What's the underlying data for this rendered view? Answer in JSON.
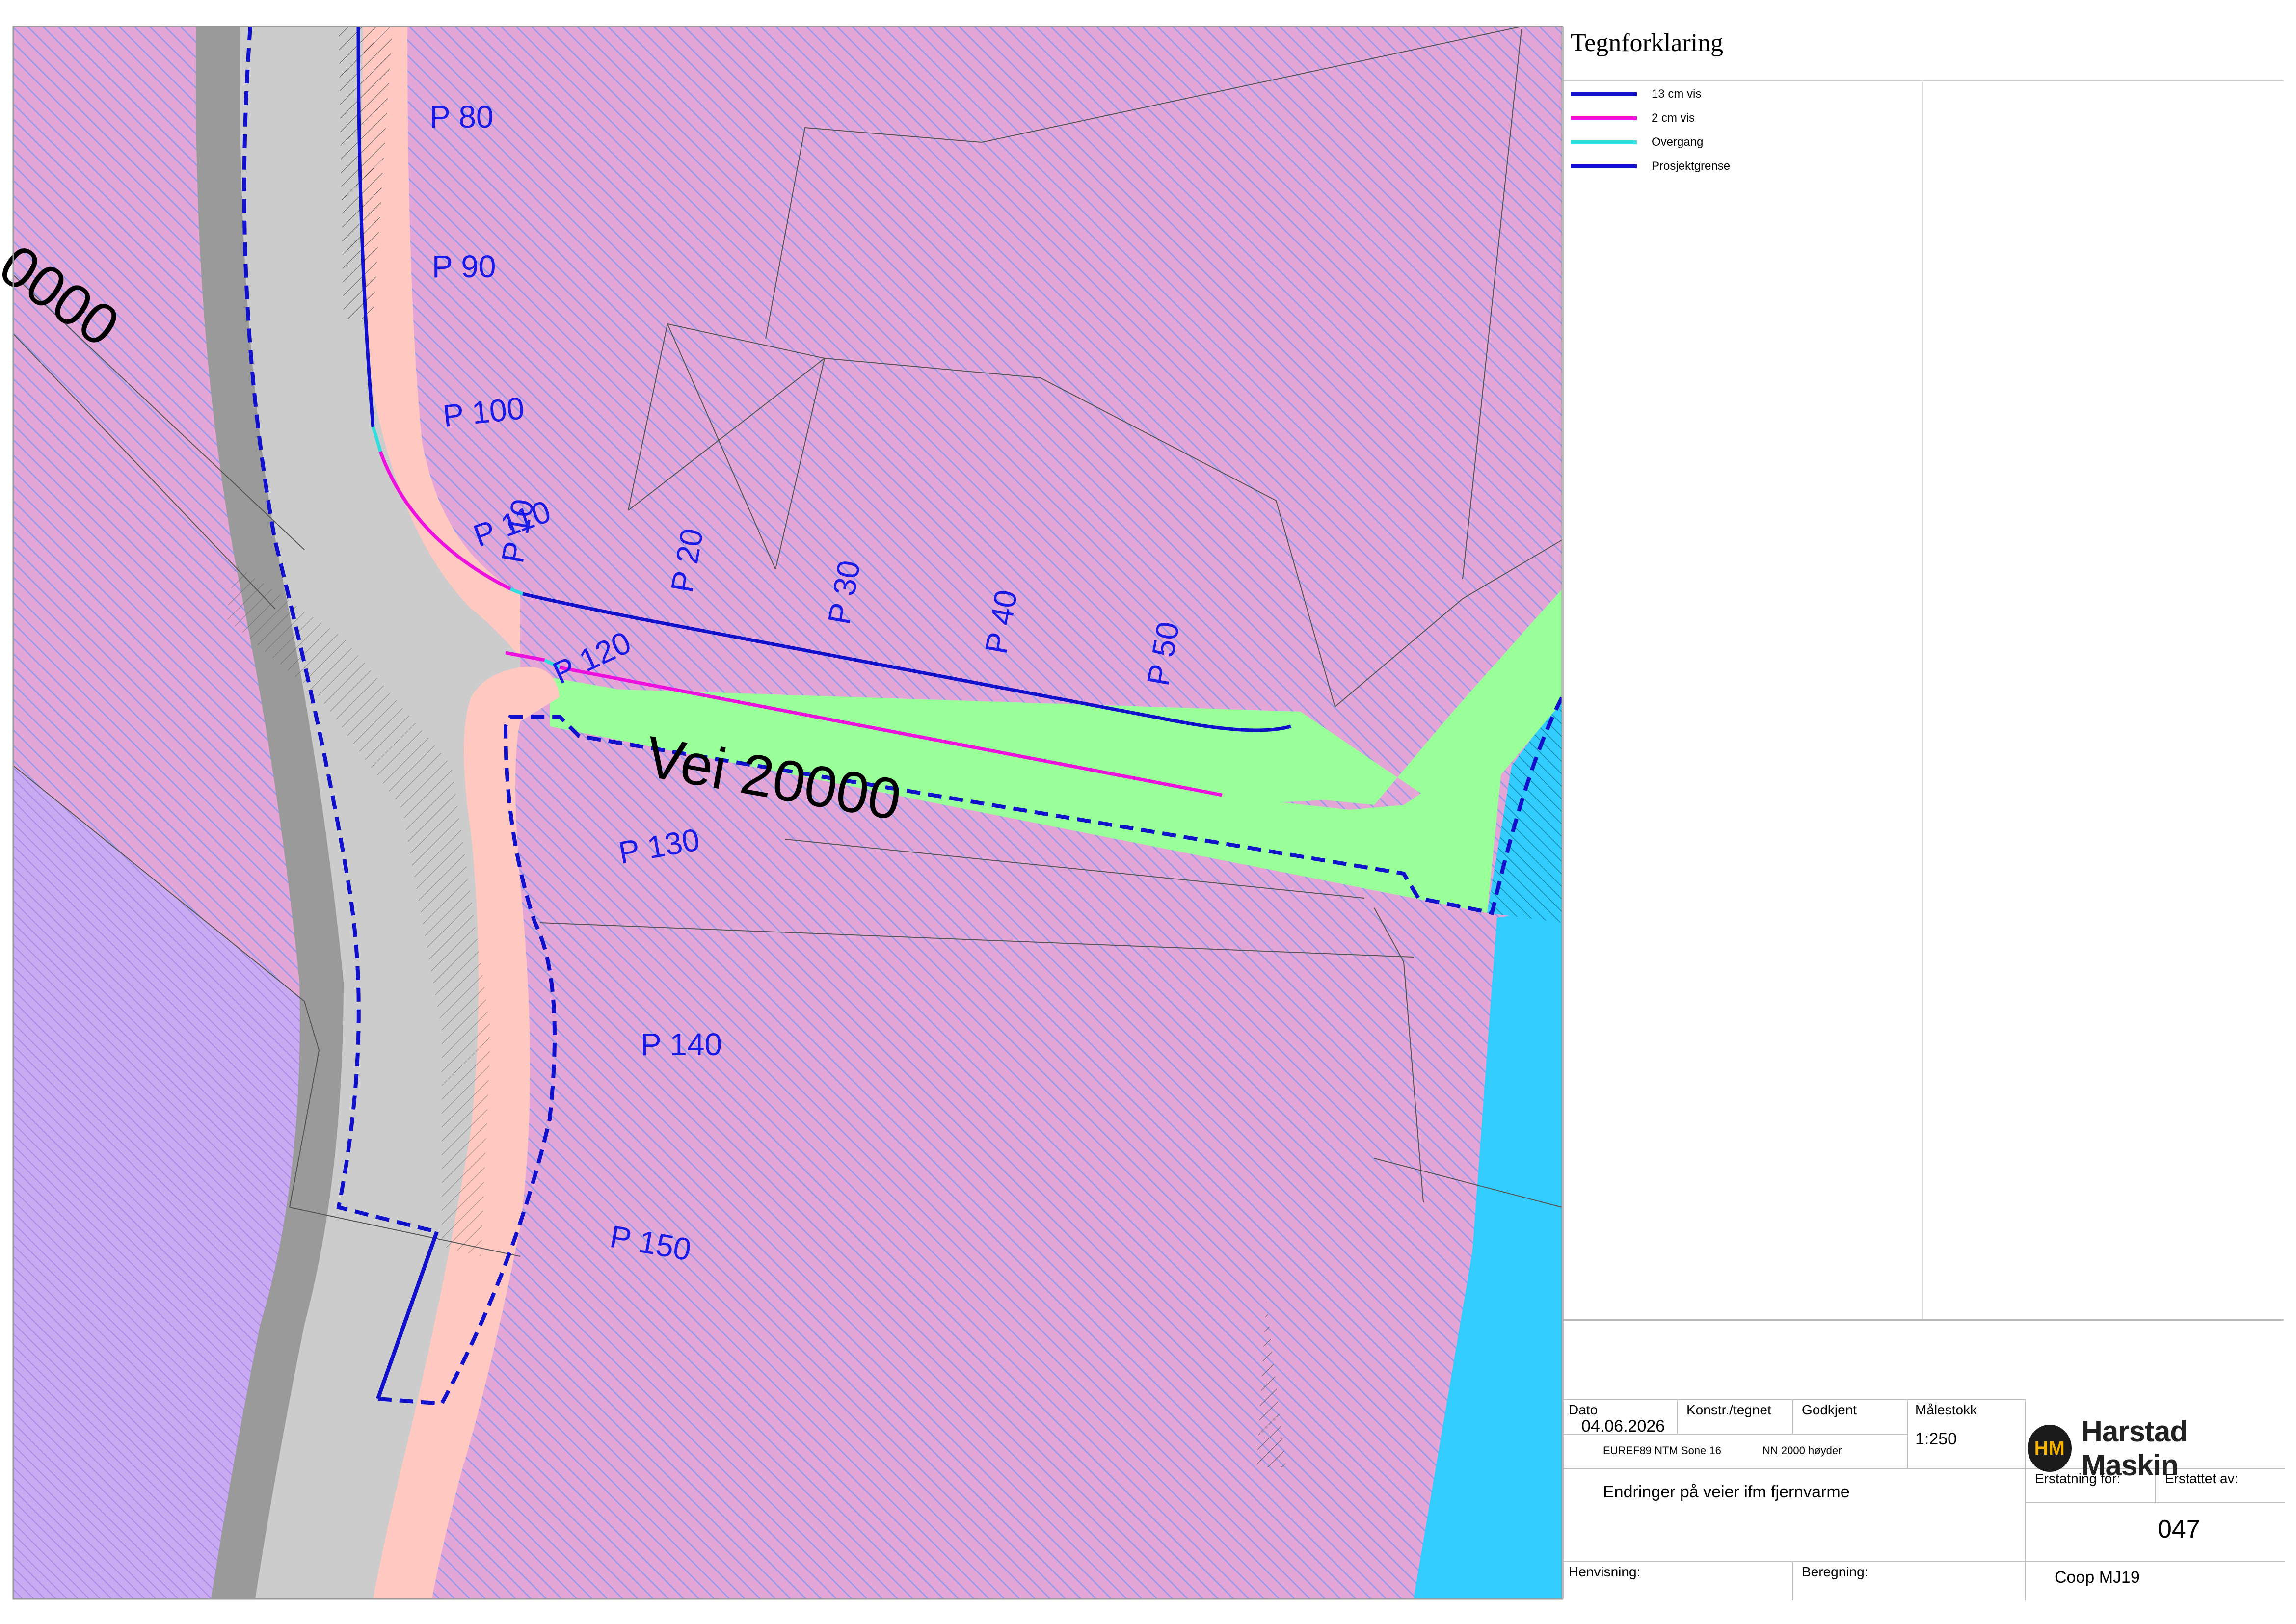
{
  "legend": {
    "title": "Tegnforklaring",
    "items": [
      {
        "label": "13 cm vis",
        "color": "#1111cc"
      },
      {
        "label": "2 cm vis",
        "color": "#ee11dd"
      },
      {
        "label": "Overgang",
        "color": "#33dddd"
      },
      {
        "label": "Prosjektgrense",
        "color": "#1111cc"
      }
    ]
  },
  "map": {
    "road_label": "Vei 20000",
    "road_label_partial": "0000",
    "points": [
      "P 80",
      "P 90",
      "P 100",
      "P 110",
      "P 10",
      "P 20",
      "P 30",
      "P 40",
      "P 50",
      "P 120",
      "P 130",
      "P 140",
      "P 150"
    ],
    "colors": {
      "zone_pink": "#e8a8d8",
      "zone_violet": "#c8a8f0",
      "road_grey": "#cccccc",
      "road_dark": "#999999",
      "sidewalk": "#ffc8c0",
      "green": "#99ff99",
      "water": "#33ccff"
    }
  },
  "titleblock": {
    "dato_label": "Dato",
    "dato_value": "04.06.2026",
    "konstr_label": "Konstr./tegnet",
    "godkjent_label": "Godkjent",
    "malestokk_label": "Målestokk",
    "malestokk_value": "1:250",
    "crs": "EUREF89 NTM Sone 16",
    "height_ref": "NN 2000 høyder",
    "company": "Harstad Maskin",
    "logo_mark": "HM",
    "erstatning_label": "Erstatning for:",
    "erstattet_label": "Erstattet av:",
    "description": "Endringer på veier ifm fjernvarme",
    "drawing_no": "047",
    "henvisning_label": "Henvisning:",
    "beregning_label": "Beregning:",
    "project": "Coop MJ19"
  }
}
